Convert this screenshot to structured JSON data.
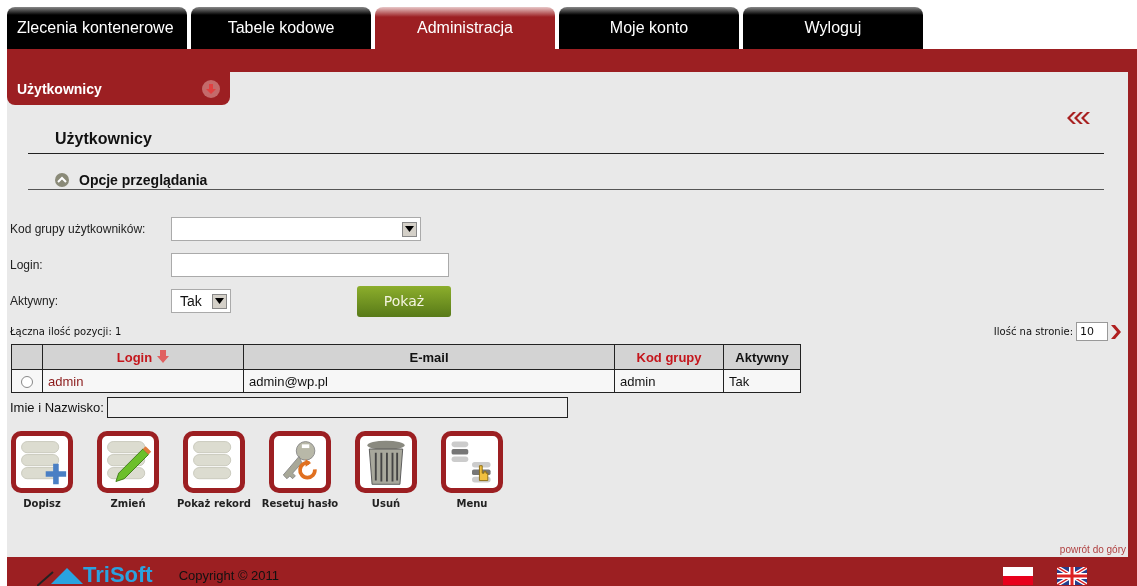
{
  "tabs": [
    {
      "label": "Zlecenia kontenerowe",
      "selected": false
    },
    {
      "label": "Tabele kodowe",
      "selected": false
    },
    {
      "label": "Administracja",
      "selected": true
    },
    {
      "label": "Moje konto",
      "selected": false
    },
    {
      "label": "Wyloguj",
      "selected": false
    }
  ],
  "section_tab": {
    "label": "Użytkownicy"
  },
  "page_title": "Użytkownicy",
  "options_header": {
    "label": "Opcje przeglądania",
    "expanded": true
  },
  "filters": [
    {
      "kind": "select",
      "label": "Kod grupy użytkowników:"
    },
    {
      "kind": "text",
      "label": "Login:"
    },
    {
      "kind": "select-small",
      "label": "Aktywny:",
      "value": "Tak"
    }
  ],
  "show_button": "Pokaż",
  "total": "Łączna ilość pozycji: 1",
  "per_page": {
    "label": "Ilość na stronie:",
    "value": "10"
  },
  "table": {
    "columns": [
      {
        "label": "Login",
        "sortable": true,
        "sorted": true,
        "link": true
      },
      {
        "label": "E-mail",
        "sortable": false,
        "sorted": false,
        "link": false
      },
      {
        "label": "Kod grupy",
        "sortable": true,
        "sorted": false,
        "link": false
      },
      {
        "label": "Aktywny",
        "sortable": false,
        "sorted": false,
        "link": false
      }
    ],
    "rows": [
      {
        "selected": false,
        "cells": [
          "admin",
          "admin@wp.pl",
          "admin",
          "Tak"
        ]
      }
    ]
  },
  "name_field": {
    "label": "Imie i Nazwisko:"
  },
  "actions": [
    {
      "kind": "add",
      "label": "Dopisz"
    },
    {
      "kind": "edit",
      "label": "Zmień"
    },
    {
      "kind": "show",
      "label": "Pokaż rekord"
    },
    {
      "kind": "reset",
      "label": "Resetuj hasło"
    },
    {
      "kind": "delete",
      "label": "Usuń"
    },
    {
      "kind": "menu",
      "label": "Menu"
    }
  ],
  "back_to_top": "powrót do góry",
  "footer": {
    "logo": "TriSoft",
    "copyright": "Copyright © 2011"
  }
}
